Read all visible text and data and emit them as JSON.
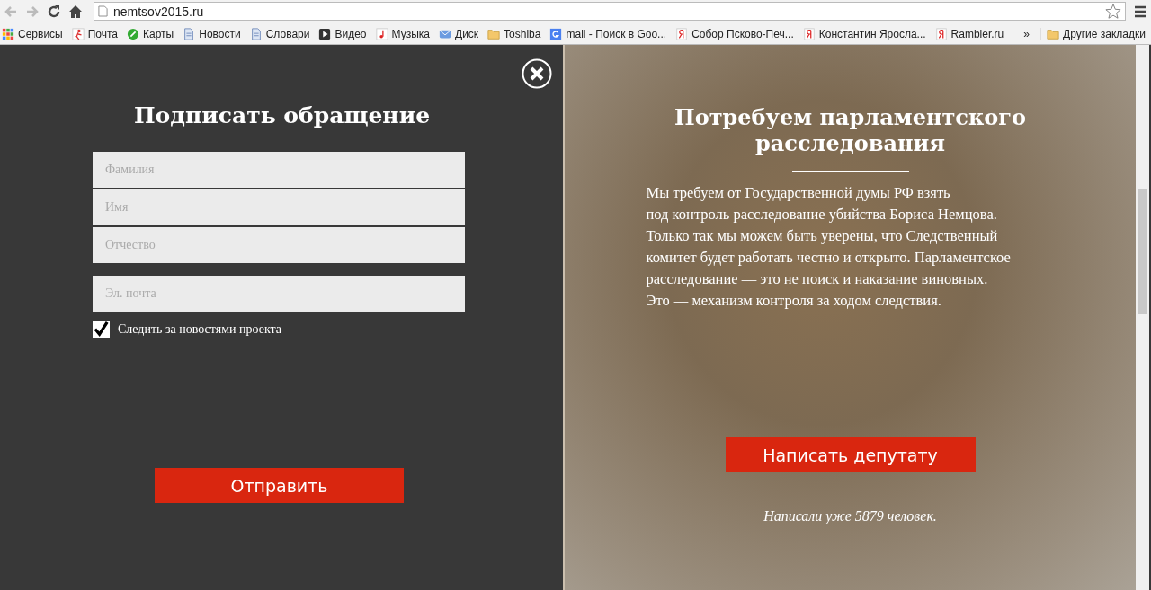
{
  "browser": {
    "url": "nemtsov2015.ru",
    "bookmarks": [
      {
        "label": "Сервисы",
        "kind": "apps"
      },
      {
        "label": "Почта",
        "kind": "mail"
      },
      {
        "label": "Карты",
        "kind": "maps"
      },
      {
        "label": "Новости",
        "kind": "page"
      },
      {
        "label": "Словари",
        "kind": "page"
      },
      {
        "label": "Видео",
        "kind": "video"
      },
      {
        "label": "Музыка",
        "kind": "music"
      },
      {
        "label": "Диск",
        "kind": "disk"
      },
      {
        "label": "Toshiba",
        "kind": "folder"
      },
      {
        "label": "mail - Поиск в Goo...",
        "kind": "google"
      },
      {
        "label": "Собор Псково-Печ...",
        "kind": "yandex"
      },
      {
        "label": "Константин Яросла...",
        "kind": "yandex"
      },
      {
        "label": "Rambler.ru",
        "kind": "yandex"
      }
    ],
    "more": "»",
    "other_bookmarks": "Другие закладки"
  },
  "form": {
    "title": "Подписать обращение",
    "fields": [
      {
        "placeholder": "Фамилия",
        "kind": "name"
      },
      {
        "placeholder": "Имя",
        "kind": "name"
      },
      {
        "placeholder": "Отчество",
        "kind": "name"
      },
      {
        "placeholder": "Эл. почта",
        "kind": "email"
      }
    ],
    "subscribe": {
      "label": "Следить за новостями проекта",
      "checked": true
    },
    "submit": "Отправить"
  },
  "appeal": {
    "title": "Потребуем парламентского расследования",
    "text": [
      "Мы требуем от Государственной думы РФ взять",
      "под контроль расследование убийства Бориса Немцова.",
      "Только так мы можем быть уверены, что Следственный",
      "комитет будет работать честно и открыто. Парламентское",
      "расследование — это не поиск и наказание виновных.",
      "Это — механизм контроля за ходом следствия."
    ],
    "button": "Написать депутату",
    "count_note": "Написали уже 5879 человек."
  }
}
